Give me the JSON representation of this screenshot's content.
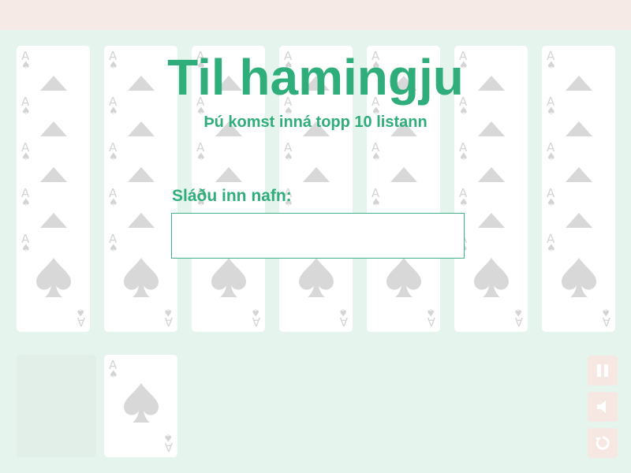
{
  "dialog": {
    "title": "Til hamingju",
    "subtitle": "Þú komst inná topp 10 listann",
    "name_label": "Sláðu inn nafn:",
    "name_value": ""
  },
  "card": {
    "rank": "A",
    "suit": "♠"
  },
  "controls": {
    "pause": {
      "icon": "pause-icon"
    },
    "sound": {
      "icon": "speaker-icon"
    },
    "restart": {
      "icon": "restart-icon"
    }
  },
  "colors": {
    "accent": "#2fad7a",
    "background": "#e6f4ee",
    "topbar": "#f6eae6",
    "control": "#f7e7e3"
  }
}
